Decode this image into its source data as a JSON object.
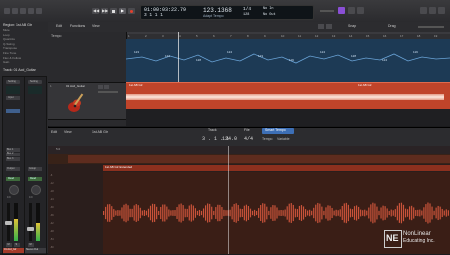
{
  "control_bar": {
    "transport_buttons": [
      "rewind",
      "forward",
      "stop",
      "play",
      "record",
      "cycle"
    ],
    "time": "01:00:03:22.79",
    "bars": "3  1  1    1",
    "tempo": "123.1368",
    "tempo_mode": "Adapt Tempo",
    "signature": "1/4",
    "signature_sub": "128",
    "key_in": "No In",
    "key_out": "No Out",
    "accent_color": "#8a4fd6"
  },
  "inspector": {
    "region_label": "Region: 1st AB Gtr",
    "track_label": "Track: 01 Acd_Guitar",
    "rows": [
      "Mute",
      "Loop",
      "Quantize",
      "Q-Swing",
      "Transpose",
      "Fine Tune",
      "Flex & Follow",
      "Gain"
    ],
    "strip_buttons": [
      "Setting",
      "EQ",
      "Input",
      "Output",
      "Group",
      "Read"
    ],
    "send_labels": [
      "Bus 1",
      "Bus 2",
      "Bus 3"
    ],
    "mute_label": "M",
    "solo_label": "S",
    "channel_names": [
      "01 Acd_Gtr",
      "Stereo Out"
    ],
    "fader_value_left": "0.0",
    "fader_value_right": "0.0"
  },
  "tracks": {
    "toolbar": [
      "Edit",
      "Functions",
      "View"
    ],
    "snap_label": "Snap",
    "drag_label": "Drag",
    "tempo_lane_label": "Tempo",
    "tempo_values": [
      "123",
      "124",
      "128",
      "124",
      "123",
      "119",
      "124",
      "128",
      "124",
      "119"
    ],
    "ruler_numbers": [
      "1",
      "2",
      "3",
      "4",
      "5",
      "6",
      "7",
      "8",
      "9",
      "10",
      "11",
      "12",
      "13",
      "14",
      "15",
      "16",
      "17",
      "18",
      "19"
    ],
    "track_name": "01 Acd_Guitar",
    "region_names": [
      "1st AB Gtr",
      "1st AB Gtr"
    ],
    "region_color": "#c0442a"
  },
  "editor": {
    "menus": [
      "Edit",
      "View"
    ],
    "region_name": "1st AB Gtr",
    "tabs": [
      "Track",
      "File"
    ],
    "active_tab": "Smart Tempo",
    "position": "3 . 1 . 1",
    "tempo_value": "124.0",
    "signature": "4/4",
    "tempo_label": "Tempo",
    "mode_label": "Variable",
    "ruler_label": "5.0",
    "region_label": "1st AB Gtr Extended",
    "db_labels": [
      "-6",
      "-12",
      "-18",
      "-24",
      "-30",
      "-36",
      "-42",
      "-48",
      "-54",
      "-60"
    ]
  },
  "watermark": {
    "logo": "NE",
    "line1": "NonLinear",
    "line2": "Educating Inc."
  }
}
